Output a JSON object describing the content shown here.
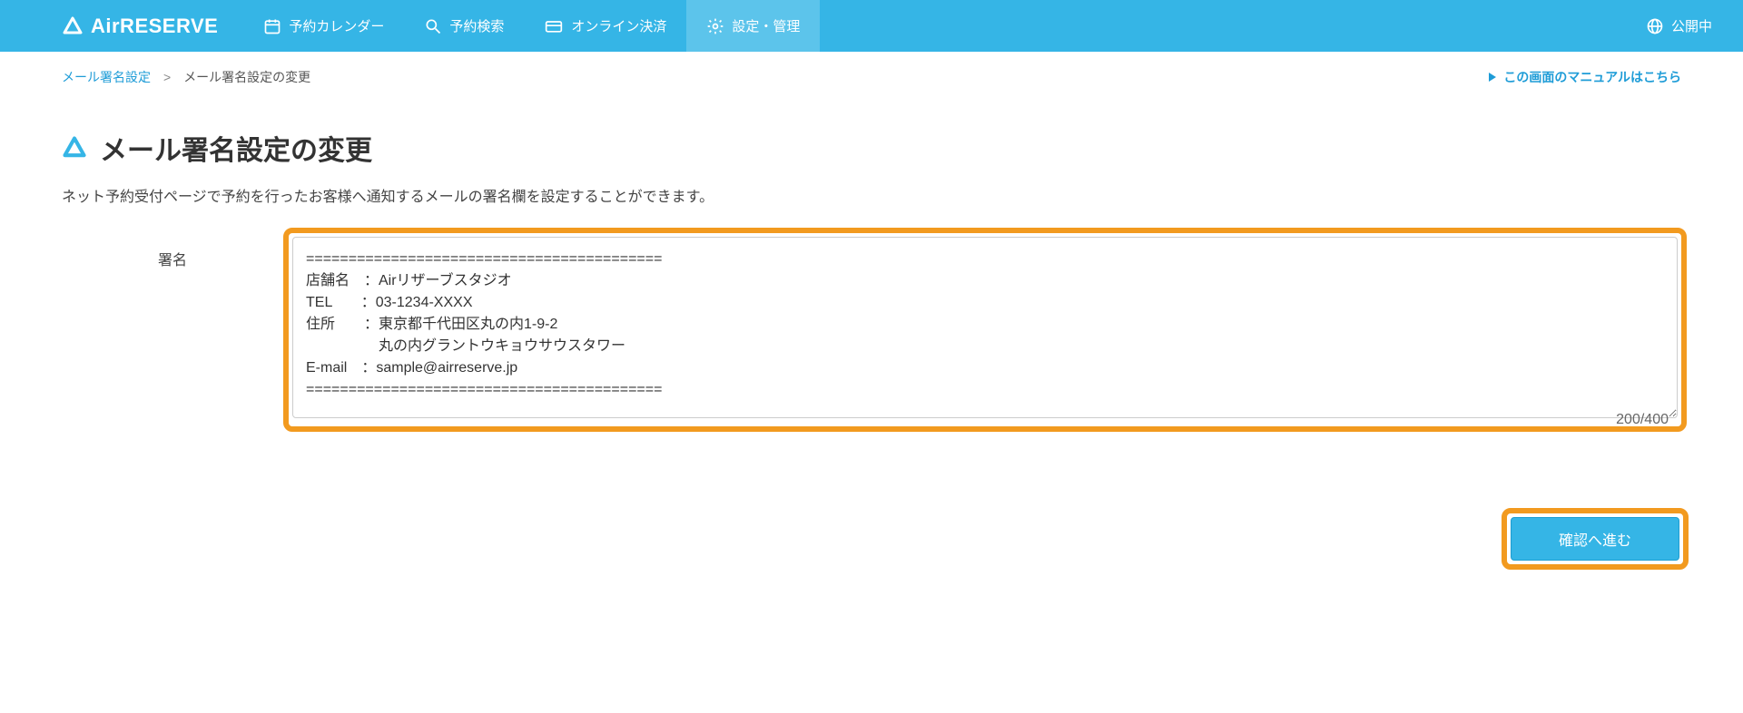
{
  "brand": {
    "name": "AirRESERVE"
  },
  "nav": {
    "calendar": "予約カレンダー",
    "search": "予約検索",
    "payment": "オンライン決済",
    "settings": "設定・管理"
  },
  "status": {
    "label": "公開中"
  },
  "breadcrumb": {
    "parent": "メール署名設定",
    "separator": ">",
    "current": "メール署名設定の変更"
  },
  "manual_link": "この画面のマニュアルはこちら",
  "page": {
    "title": "メール署名設定の変更",
    "description": "ネット予約受付ページで予約を行ったお客様へ通知するメールの署名欄を設定することができます。"
  },
  "form": {
    "label": "署名",
    "value": "==========================================\n店舗名　：Airリザーブスタジオ\nTEL　　：03-1234-XXXX\n住所　　：東京都千代田区丸の内1-9-2\n　　　　　丸の内グラントウキョウサウスタワー\nE-mail　：sample@airreserve.jp\n==========================================",
    "counter": "200/400"
  },
  "actions": {
    "confirm": "確認へ進む"
  },
  "colors": {
    "brand": "#35b5e6",
    "highlight": "#f29a1f",
    "link": "#1e9cd7"
  }
}
